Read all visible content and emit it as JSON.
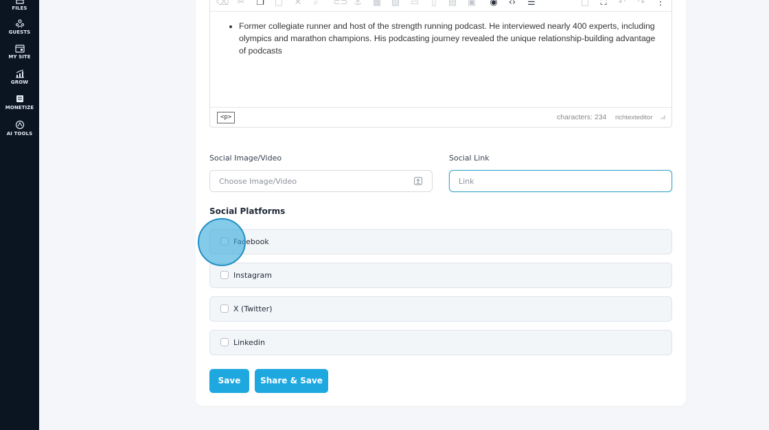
{
  "sidebar": {
    "items": [
      {
        "label": "FILES",
        "icon": "files-icon"
      },
      {
        "label": "GUESTS",
        "icon": "guests-icon"
      },
      {
        "label": "MY SITE",
        "icon": "my-site-icon"
      },
      {
        "label": "GROW",
        "icon": "grow-chart-icon"
      },
      {
        "label": "MONETIZE",
        "icon": "monetize-icon"
      },
      {
        "label": "AI TOOLS",
        "icon": "ai-tools-icon"
      }
    ]
  },
  "editor": {
    "content": "Former collegiate runner and host of the strength running podcast. He interviewed nearly 400 experts, including olympics and marathon champions. His podcasting journey revealed the unique relationship-building advantage of podcasts",
    "path_tag": "<p>",
    "char_count": "characters: 234",
    "brand": "richtexteditor"
  },
  "social": {
    "image_label": "Social Image/Video",
    "image_placeholder": "Choose Image/Video",
    "link_label": "Social Link",
    "link_placeholder": "Link"
  },
  "platforms": {
    "title": "Social Platforms",
    "items": [
      "Facebook",
      "Instagram",
      "X (Twitter)",
      "Linkedin"
    ]
  },
  "buttons": {
    "save": "Save",
    "share_save": "Share & Save"
  },
  "colors": {
    "sidebar_bg": "#0b1522",
    "accent": "#1fa8e0",
    "focus_border": "#3aa6c9"
  }
}
